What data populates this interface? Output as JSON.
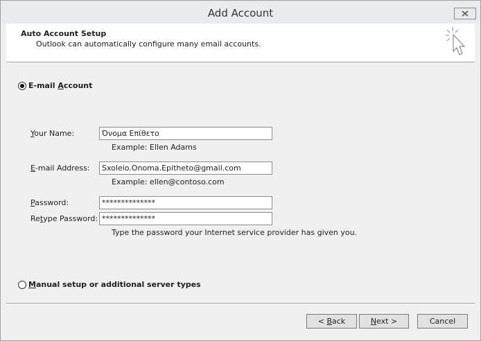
{
  "window": {
    "title": "Add Account"
  },
  "header": {
    "title": "Auto Account Setup",
    "subtitle": "Outlook can automatically configure many email accounts."
  },
  "email_option": {
    "label_pre": "E-mail ",
    "label_key": "A",
    "label_post": "ccount",
    "selected": true
  },
  "fields": {
    "name": {
      "label_key": "Y",
      "label_rest": "our Name:",
      "value": "Όνομα Επίθετο",
      "example": "Example: Ellen Adams"
    },
    "email": {
      "label_key": "E",
      "label_rest": "-mail Address:",
      "value": "Sxoleio.Onoma.Epitheto@gmail.com",
      "example": "Example: ellen@contoso.com"
    },
    "password": {
      "label_key": "P",
      "label_rest": "assword:",
      "value": "**************"
    },
    "retype": {
      "label_pre": "Re",
      "label_key": "t",
      "label_rest": "ype Password:",
      "value": "**************"
    },
    "password_hint": "Type the password your Internet service provider has given you."
  },
  "manual_option": {
    "label_key": "M",
    "label_rest": "anual setup or additional server types",
    "selected": false
  },
  "buttons": {
    "back_pre": "< ",
    "back_key": "B",
    "back_rest": "ack",
    "next_key": "N",
    "next_rest": "ext >",
    "cancel": "Cancel"
  }
}
